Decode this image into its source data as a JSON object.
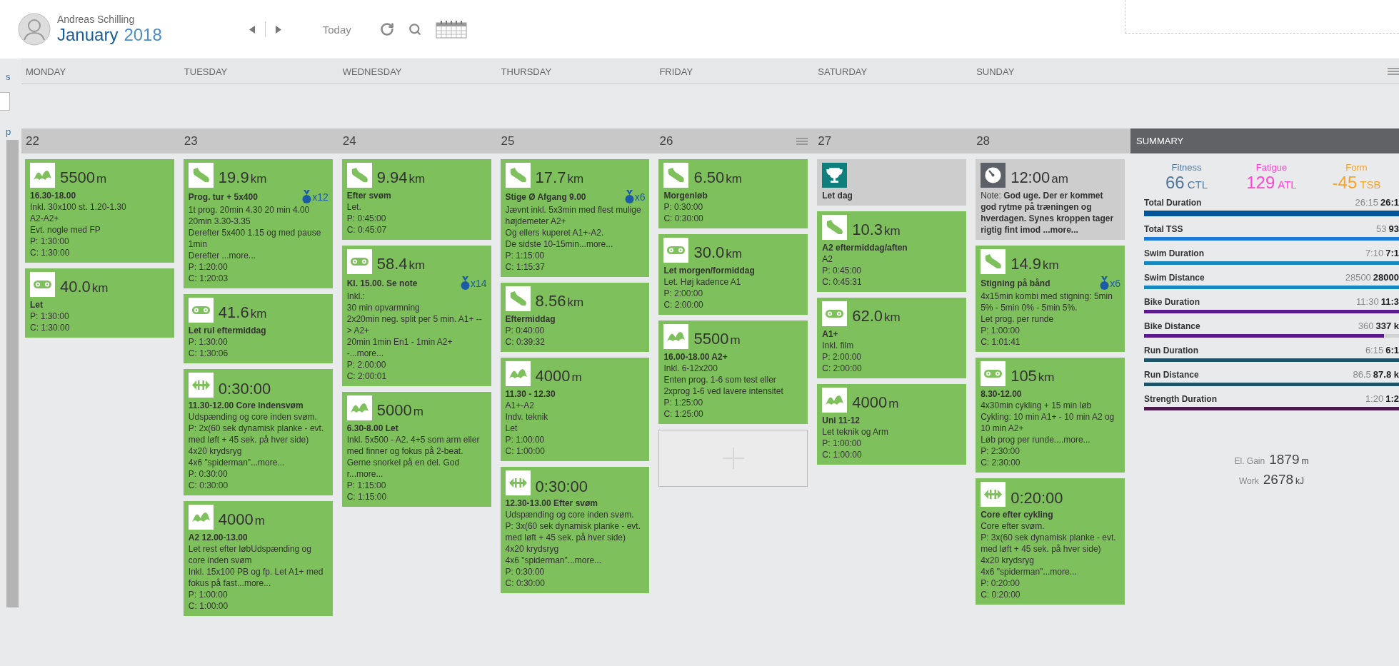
{
  "header": {
    "user_name": "Andreas Schilling",
    "month": "January",
    "year": "2018",
    "today": "Today"
  },
  "left_strip": {
    "top_link": "s",
    "bottom_link": "p"
  },
  "days": [
    {
      "name": "MONDAY",
      "date": "22",
      "menu": false,
      "cards": [
        {
          "kind": "swim",
          "value": "5500",
          "unit": "m",
          "title": "16.30-18.00",
          "lines": [
            "Inkl. 30x100 st. 1.20-1.30",
            "A2-A2+",
            "Evt. nogle med FP"
          ],
          "planned": "P: 1:30:00",
          "completed": "C: 1:30:00"
        },
        {
          "kind": "bike",
          "value": "40.0",
          "unit": "km",
          "title": "Let",
          "planned": "P: 1:30:00",
          "completed": "C: 1:30:00"
        }
      ]
    },
    {
      "name": "TUESDAY",
      "date": "23",
      "menu": false,
      "cards": [
        {
          "kind": "run",
          "value": "19.9",
          "unit": "km",
          "title": "Prog. tur + 5x400",
          "medal": "x12",
          "lines": [
            "1t prog. 20min 4.30 20 min 4.00 20min 3.30-3.35",
            "Derefter 5x400 1.15 og med pause 1min",
            "Derefter ...more..."
          ],
          "planned": "P: 1:20:00",
          "completed": "C: 1:20:03"
        },
        {
          "kind": "bike",
          "value": "41.6",
          "unit": "km",
          "title": "Let rul eftermiddag",
          "planned": "P: 1:30:00",
          "completed": "C: 1:30:06"
        },
        {
          "kind": "strength",
          "value": "0:30:00",
          "title": "11.30-12.00 Core indensvøm",
          "lines": [
            "Udspænding og core inden svøm.",
            "P: 2x(60 sek dynamisk planke - evt. med løft + 45 sek. på hver side)",
            "4x20 krydsryg",
            "4x6 \"spiderman\"...more..."
          ],
          "planned": "P: 0:30:00",
          "completed": "C: 0:30:00"
        },
        {
          "kind": "swim",
          "value": "4000",
          "unit": "m",
          "title": "A2 12.00-13.00",
          "lines": [
            "Let rest efter løbUdspænding og core inden svøm",
            "Inkl. 15x100 PB og fp. Let A1+ med fokus på fast...more..."
          ],
          "planned": "P: 1:00:00",
          "completed": "C: 1:00:00"
        }
      ]
    },
    {
      "name": "WEDNESDAY",
      "date": "24",
      "menu": false,
      "cards": [
        {
          "kind": "run",
          "value": "9.94",
          "unit": "km",
          "title": "Efter svøm",
          "lines": [
            "Let."
          ],
          "planned": "P: 0:45:00",
          "completed": "C: 0:45:07"
        },
        {
          "kind": "bike",
          "value": "58.4",
          "unit": "km",
          "title": "Kl. 15.00. Se note",
          "medal": "x14",
          "lines": [
            "Inkl.:",
            "30 min opvarmning",
            "2x20min neg. split per 5 min. A1+ --> A2+",
            "20min 1min En1 - 1min A2+ -...more..."
          ],
          "planned": "P: 2:00:00",
          "completed": "C: 2:00:01"
        },
        {
          "kind": "swim",
          "value": "5000",
          "unit": "m",
          "title": "6.30-8.00 Let",
          "lines": [
            "Inkl. 5x500 - A2. 4+5 som arm eller med finner og fokus på 2-beat. Gerne snorkel på en del. God r...more..."
          ],
          "planned": "P: 1:15:00",
          "completed": "C: 1:15:00"
        }
      ]
    },
    {
      "name": "THURSDAY",
      "date": "25",
      "menu": false,
      "cards": [
        {
          "kind": "run",
          "value": "17.7",
          "unit": "km",
          "title": "Stige Ø Afgang 9.00",
          "medal": "x6",
          "lines": [
            "Jævnt inkl. 5x3min med flest mulige højdemeter A2+",
            "Og ellers kuperet A1+-A2.",
            "De sidste 10-15min...more..."
          ],
          "planned": "P: 1:15:00",
          "completed": "C: 1:15:37"
        },
        {
          "kind": "run",
          "value": "8.56",
          "unit": "km",
          "title": "Eftermiddag",
          "planned": "P: 0:40:00",
          "completed": "C: 0:39:32"
        },
        {
          "kind": "swim",
          "value": "4000",
          "unit": "m",
          "title": "11.30 - 12.30",
          "lines": [
            "A1+-A2",
            "Indv. teknik",
            "Let"
          ],
          "planned": "P: 1:00:00",
          "completed": "C: 1:00:00"
        },
        {
          "kind": "strength",
          "value": "0:30:00",
          "title": "12.30-13.00 Efter svøm",
          "lines": [
            "Udspænding og core inden svøm.",
            "P: 3x(60 sek dynamisk planke - evt. med løft + 45 sek. på hver side)",
            "4x20 krydsryg",
            "4x6 \"spiderman\"...more..."
          ],
          "planned": "P: 0:30:00",
          "completed": "C: 0:30:00"
        }
      ]
    },
    {
      "name": "FRIDAY",
      "date": "26",
      "menu": true,
      "cards": [
        {
          "kind": "run",
          "value": "6.50",
          "unit": "km",
          "title": "Morgenløb",
          "planned": "P: 0:30:00",
          "completed": "C: 0:30:00"
        },
        {
          "kind": "bike",
          "value": "30.0",
          "unit": "km",
          "title": "Let morgen/formiddag",
          "lines": [
            "Let. Høj kadence A1"
          ],
          "planned": "P: 2:00:00",
          "completed": "C: 2:00:00"
        },
        {
          "kind": "swim",
          "value": "5500",
          "unit": "m",
          "title": "16.00-18.00 A2+",
          "lines": [
            "Inkl. 6-12x200",
            "Enten prog. 1-6 som test eller 2xprog 1-6 ved lavere intensitet"
          ],
          "planned": "P: 1:25:00",
          "completed": "C: 1:25:00"
        },
        {
          "kind": "add"
        }
      ]
    },
    {
      "name": "SATURDAY",
      "date": "27",
      "menu": false,
      "cards": [
        {
          "kind": "goal",
          "title": "Let dag"
        },
        {
          "kind": "run",
          "value": "10.3",
          "unit": "km",
          "title": "A2 eftermiddag/aften",
          "lines": [
            "A2"
          ],
          "planned": "P: 0:45:00",
          "completed": "C: 0:45:31"
        },
        {
          "kind": "bike",
          "value": "62.0",
          "unit": "km",
          "title": "A1+",
          "lines": [
            "Inkl. film"
          ],
          "planned": "P: 2:00:00",
          "completed": "C: 2:00:00"
        },
        {
          "kind": "swim",
          "value": "4000",
          "unit": "m",
          "title": "Uni 11-12",
          "lines": [
            "Let teknik og Arm"
          ],
          "planned": "P: 1:00:00",
          "completed": "C: 1:00:00"
        }
      ]
    },
    {
      "name": "SUNDAY",
      "date": "28",
      "menu": false,
      "cards": [
        {
          "kind": "note",
          "value": "12:00",
          "unit": "am",
          "text": "Note: **God uge. Der er kommet god rytme på træningen og hverdagen. Synes kroppen tager rigtig fint imod ...more...**"
        },
        {
          "kind": "run",
          "value": "14.9",
          "unit": "km",
          "title": "Stigning på bånd",
          "medal": "x6",
          "lines": [
            "4x15min kombi med stigning: 5min 5% - 5min 0% - 5min 5%.",
            "Let prog. per runde"
          ],
          "planned": "P: 1:00:00",
          "completed": "C: 1:01:41"
        },
        {
          "kind": "bike",
          "value": "105",
          "unit": "km",
          "title": "8.30-12.00",
          "lines": [
            "4x30min cykling + 15 min løb",
            "Cykling: 10 min A1+ - 10 min A2 og 10 min A2+",
            "Løb prog per runde....more..."
          ],
          "planned": "P: 2:30:00",
          "completed": "C: 2:30:00"
        },
        {
          "kind": "strength",
          "value": "0:20:00",
          "title": "Core efter cykling",
          "lines": [
            "Core efter svøm.",
            "P: 3x(60 sek dynamisk planke - evt. med løft + 45 sek. på hver side)",
            "4x20 krydsryg",
            "4x6 \"spiderman\"...more..."
          ],
          "planned": "P: 0:20:00",
          "completed": "C: 0:20:00"
        }
      ]
    }
  ],
  "summary": {
    "title": "SUMMARY",
    "metrics": [
      {
        "label": "Fitness",
        "value": "66",
        "unit": "CTL",
        "color": "#50769c"
      },
      {
        "label": "Fatigue",
        "value": "129",
        "unit": "ATL",
        "color": "#ff45d2"
      },
      {
        "label": "Form",
        "value": "-45",
        "unit": "TSB",
        "color": "#f7a42a"
      }
    ],
    "bars": [
      {
        "label": "Total Duration",
        "planned": "26:15",
        "completed": "26:1",
        "color": "#005596",
        "level": 1
      },
      {
        "label": "Total TSS",
        "planned": "53",
        "completed": "93",
        "color": "#1a7ad6",
        "level": 1
      },
      {
        "label": "Swim Duration",
        "planned": "7:10",
        "completed": "7:1",
        "color": "#1688bf",
        "level": 1
      },
      {
        "label": "Swim Distance",
        "planned": "28500",
        "completed": "28000",
        "color": "#1688bf",
        "level": 1
      },
      {
        "label": "Bike Duration",
        "planned": "11:30",
        "completed": "11:3",
        "color": "#5a1a8e",
        "level": 1
      },
      {
        "label": "Bike Distance",
        "planned": "360",
        "completed": "337 k",
        "color": "#5a1a8e",
        "level": 0.94
      },
      {
        "label": "Run Duration",
        "planned": "6:15",
        "completed": "6:1",
        "color": "#1f5468",
        "level": 1
      },
      {
        "label": "Run Distance",
        "planned": "86.5",
        "completed": "87.8 k",
        "color": "#1f5468",
        "level": 1
      },
      {
        "label": "Strength Duration",
        "planned": "1:20",
        "completed": "1:2",
        "color": "#4b1a4d",
        "level": 1
      }
    ],
    "totals": [
      {
        "label": "El. Gain",
        "value": "1879",
        "unit": "m"
      },
      {
        "label": "Work",
        "value": "2678",
        "unit": "kJ"
      }
    ]
  }
}
